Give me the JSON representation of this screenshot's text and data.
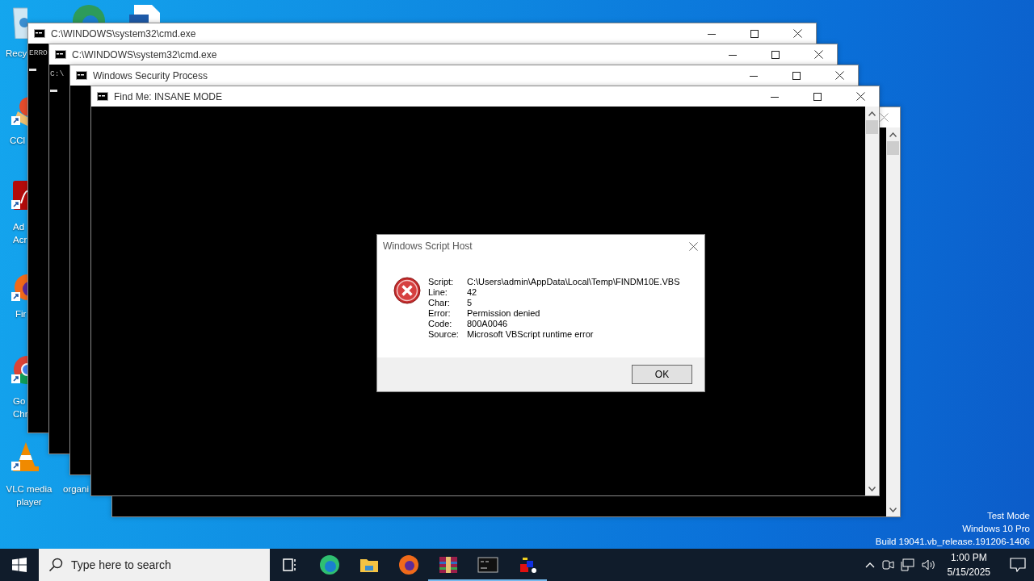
{
  "desktop": {
    "icons": [
      {
        "kind": "bin",
        "lines": [
          "Recy"
        ]
      },
      {
        "kind": "swirl"
      },
      {
        "kind": "document"
      },
      {
        "kind": "broom",
        "lines": [
          "CCl"
        ]
      },
      {
        "kind": "pdf",
        "lines": [
          "Ad",
          "Acr"
        ]
      },
      {
        "kind": "fox",
        "lines": [
          "Fir"
        ]
      },
      {
        "kind": "wheel",
        "lines": [
          "Go",
          "Chr"
        ]
      },
      {
        "kind": "cone",
        "lines": [
          "VLC media",
          "player"
        ]
      },
      {
        "kind": "none",
        "lines": [
          "organi"
        ]
      }
    ],
    "build_info": [
      "Test Mode",
      "Windows 10 Pro",
      "Build 19041.vb_release.191206-1406"
    ]
  },
  "windows": [
    {
      "kind": "console",
      "title": "C:\\WINDOWS\\system32\\cmd.exe",
      "lines": [
        "ERRO"
      ],
      "cursor": true,
      "scrollbar": false
    },
    {
      "kind": "console",
      "title": "C:\\WINDOWS\\system32\\cmd.exe",
      "lines": [
        "C:\\"
      ],
      "cursor": true,
      "scrollbar": false
    },
    {
      "kind": "console",
      "title": "Windows Security Process",
      "cursor": false,
      "scrollbar": false
    },
    {
      "kind": "back",
      "cursor": false,
      "scrollbar": true
    },
    {
      "kind": "console",
      "title": "Find Me: INSANE MODE",
      "cursor": false,
      "scrollbar": true
    }
  ],
  "dialog": {
    "title": "Windows Script Host",
    "fields": [
      {
        "label": "Script:",
        "value": "C:\\Users\\admin\\AppData\\Local\\Temp\\FINDM10E.VBS"
      },
      {
        "label": "Line:",
        "value": "42"
      },
      {
        "label": "Char:",
        "value": "5"
      },
      {
        "label": "Error:",
        "value": "Permission denied"
      },
      {
        "label": "Code:",
        "value": "800A0046"
      },
      {
        "label": "Source:",
        "value": "Microsoft VBScript runtime error"
      }
    ],
    "buttons": [
      "OK"
    ]
  },
  "taskbar": {
    "search": {
      "placeholder": "Type here to search"
    },
    "apps": [
      {
        "kind": "task-view",
        "open": false
      },
      {
        "kind": "swirl",
        "open": false
      },
      {
        "kind": "folder",
        "open": false
      },
      {
        "kind": "fox",
        "open": false
      },
      {
        "kind": "archive",
        "open": true
      },
      {
        "kind": "terminal",
        "open": true
      },
      {
        "kind": "cubes",
        "open": true
      }
    ],
    "clock": {
      "time": "1:00 PM",
      "date": "5/15/2025"
    }
  }
}
